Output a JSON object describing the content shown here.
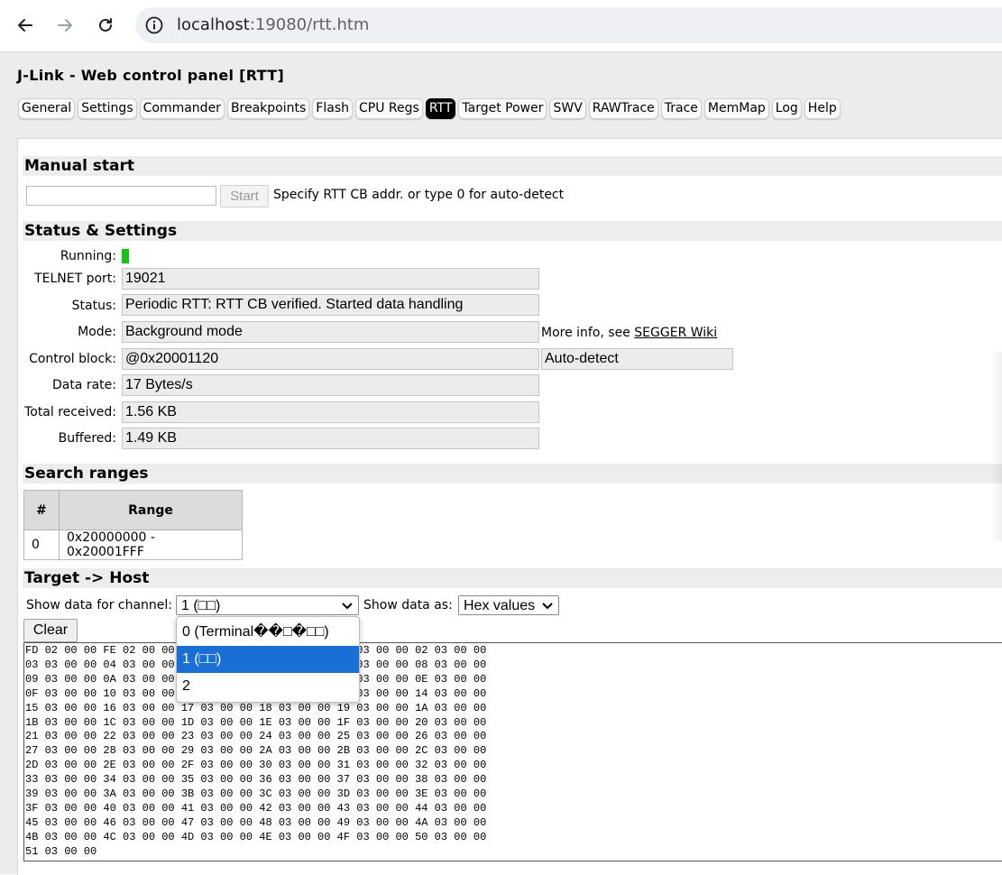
{
  "browser": {
    "url_host": "localhost",
    "url_rest": ":19080/rtt.htm"
  },
  "app": {
    "title": "J-Link - Web control panel [RTT]",
    "tabs": [
      {
        "label": "General"
      },
      {
        "label": "Settings"
      },
      {
        "label": "Commander"
      },
      {
        "label": "Breakpoints"
      },
      {
        "label": "Flash"
      },
      {
        "label": "CPU Regs"
      },
      {
        "label": "RTT",
        "active": true
      },
      {
        "label": "Target Power"
      },
      {
        "label": "SWV"
      },
      {
        "label": "RAWTrace"
      },
      {
        "label": "Trace"
      },
      {
        "label": "MemMap"
      },
      {
        "label": "Log"
      },
      {
        "label": "Help"
      }
    ]
  },
  "manual_start": {
    "heading": "Manual start",
    "input_value": "",
    "start_label": "Start",
    "hint": "Specify RTT CB addr. or type 0 for auto-detect"
  },
  "status": {
    "heading": "Status & Settings",
    "running_label": "Running:",
    "running_color": "#12c312",
    "telnet_label": "TELNET port:",
    "telnet_value": "19021",
    "status_label": "Status:",
    "status_value": "Periodic RTT: RTT CB verified. Started data handling",
    "mode_label": "Mode:",
    "mode_value": "Background mode",
    "more_info_text": "More info, see ",
    "more_info_link": "SEGGER Wiki",
    "cb_label": "Control block:",
    "cb_value": "@0x20001120",
    "cb_mode": "Auto-detect",
    "rate_label": "Data rate:",
    "rate_value": "17 Bytes/s",
    "total_label": "Total received:",
    "total_value": "1.56 KB",
    "buffered_label": "Buffered:",
    "buffered_value": "1.49 KB"
  },
  "search_ranges": {
    "heading": "Search ranges",
    "col_num": "#",
    "col_range": "Range",
    "rows": [
      {
        "num": "0",
        "range": "0x20000000 - 0x20001FFF"
      }
    ]
  },
  "target_host": {
    "heading": "Target -> Host",
    "channel_label": "Show data for channel:",
    "channel_selected": "1 (□□)",
    "as_label": "Show data as:",
    "as_selected": "Hex values",
    "clear_label": "Clear",
    "dropdown_options": [
      "0 (Terminal��□�□□)",
      "1 (□□)",
      "2"
    ],
    "hex_lines": [
      "FD 02 00 00 FE 02 00 00 FF 02 00 00 00 03 00 00 01 03 00 00 02 03 00 00",
      "03 03 00 00 04 03 00 00 05 03 00 00 06 03 00 00 07 03 00 00 08 03 00 00",
      "09 03 00 00 0A 03 00 00 0B 03 00 00 0C 03 00 00 0D 03 00 00 0E 03 00 00",
      "0F 03 00 00 10 03 00 00 11 03 00 00 12 03 00 00 13 03 00 00 14 03 00 00",
      "15 03 00 00 16 03 00 00 17 03 00 00 18 03 00 00 19 03 00 00 1A 03 00 00",
      "1B 03 00 00 1C 03 00 00 1D 03 00 00 1E 03 00 00 1F 03 00 00 20 03 00 00",
      "21 03 00 00 22 03 00 00 23 03 00 00 24 03 00 00 25 03 00 00 26 03 00 00",
      "27 03 00 00 28 03 00 00 29 03 00 00 2A 03 00 00 2B 03 00 00 2C 03 00 00",
      "2D 03 00 00 2E 03 00 00 2F 03 00 00 30 03 00 00 31 03 00 00 32 03 00 00",
      "33 03 00 00 34 03 00 00 35 03 00 00 36 03 00 00 37 03 00 00 38 03 00 00",
      "39 03 00 00 3A 03 00 00 3B 03 00 00 3C 03 00 00 3D 03 00 00 3E 03 00 00",
      "3F 03 00 00 40 03 00 00 41 03 00 00 42 03 00 00 43 03 00 00 44 03 00 00",
      "45 03 00 00 46 03 00 00 47 03 00 00 48 03 00 00 49 03 00 00 4A 03 00 00",
      "4B 03 00 00 4C 03 00 00 4D 03 00 00 4E 03 00 00 4F 03 00 00 50 03 00 00",
      "51 03 00 00"
    ]
  }
}
